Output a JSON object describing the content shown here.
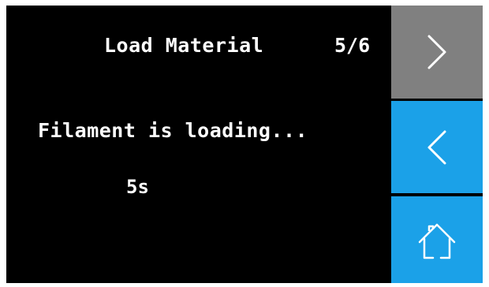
{
  "screen": {
    "title": "Load Material",
    "step": "5/6",
    "message": "Filament is loading...",
    "timer": "5s"
  },
  "sidebar": {
    "next": {
      "icon": "chevron-right-icon",
      "color": "#808080"
    },
    "back": {
      "icon": "chevron-left-icon",
      "color": "#1ba1e8"
    },
    "home": {
      "icon": "home-icon",
      "color": "#1ba1e8"
    }
  },
  "colors": {
    "background": "#000000",
    "text": "#ffffff",
    "icon": "#ffffff"
  }
}
